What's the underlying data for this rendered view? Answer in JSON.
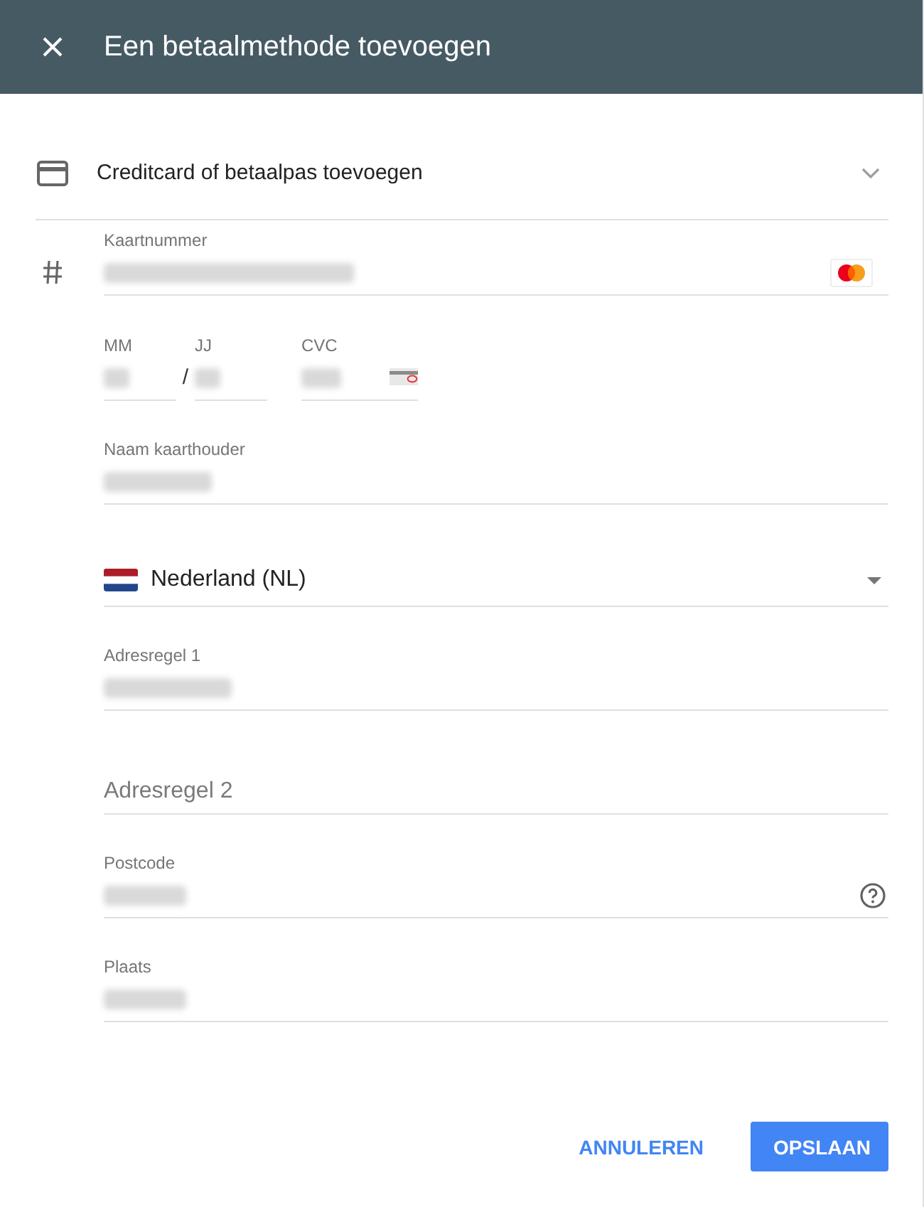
{
  "header": {
    "title": "Een betaalmethode toevoegen"
  },
  "method": {
    "label": "Creditcard of betaalpas toevoegen"
  },
  "card_number": {
    "label": "Kaartnummer",
    "redacted": true
  },
  "expiry": {
    "month": {
      "label": "MM",
      "redacted": true
    },
    "separator": "/",
    "year": {
      "label": "JJ",
      "redacted": true
    }
  },
  "cvc": {
    "label": "CVC",
    "redacted": true
  },
  "cardholder": {
    "label": "Naam kaarthouder",
    "redacted": true
  },
  "country": {
    "value": "Nederland (NL)"
  },
  "address_fields": [
    {
      "label": "Adresregel 1",
      "redacted": true,
      "help": false
    },
    {
      "placeholder": "Adresregel 2",
      "redacted": false,
      "help": false
    },
    {
      "label": "Postcode",
      "redacted": true,
      "help": true
    },
    {
      "label": "Plaats",
      "redacted": true,
      "help": false
    }
  ],
  "buttons": [
    {
      "label": "ANNULEREN",
      "kind": "text"
    },
    {
      "label": "OPSLAAN",
      "kind": "primary"
    }
  ]
}
